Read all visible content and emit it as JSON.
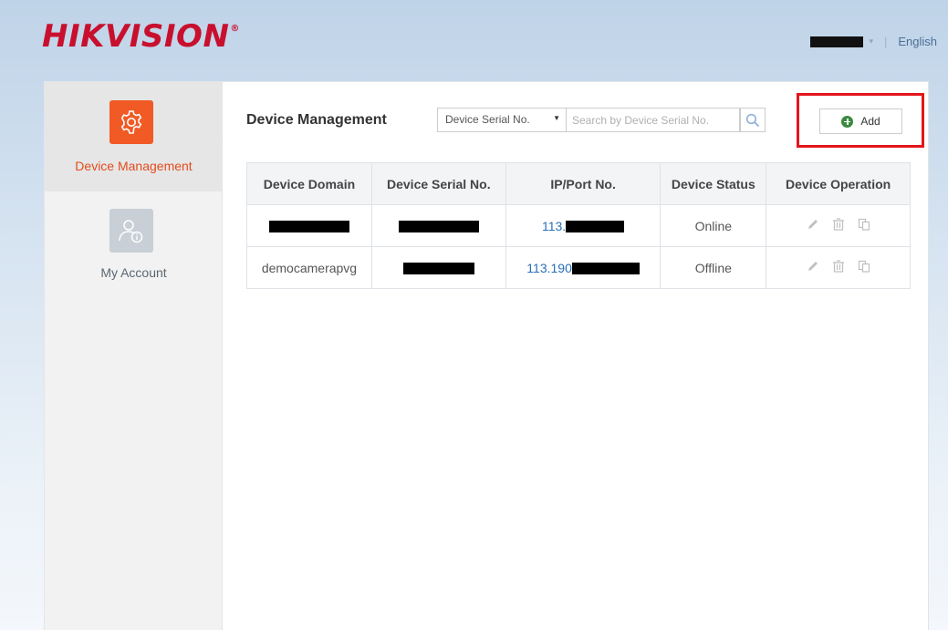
{
  "header": {
    "logo_text": "HIKVISION",
    "logo_mark": "®",
    "user_caret": "▾",
    "language_label": "English"
  },
  "sidebar": {
    "items": [
      {
        "label": "Device Management",
        "icon": "gear-icon",
        "active": true
      },
      {
        "label": "My Account",
        "icon": "account-icon",
        "active": false
      }
    ]
  },
  "main": {
    "title": "Device Management",
    "filter_select_value": "Device Serial No.",
    "filter_arrow": "▼",
    "search_placeholder": "Search by Device Serial No.",
    "add_label": "Add"
  },
  "table": {
    "headers": [
      "Device Domain",
      "Device Serial No.",
      "IP/Port No.",
      "Device Status",
      "Device Operation"
    ],
    "rows": [
      {
        "domain": "",
        "serial": "",
        "ip_prefix": "113.",
        "status": "Online"
      },
      {
        "domain": "democamerapvg",
        "serial": "",
        "ip_prefix": "113.190",
        "status": "Offline"
      }
    ]
  },
  "colors": {
    "brand_red": "#c8102e",
    "accent_orange": "#f15a24",
    "online_green": "#5aa22e",
    "offline_orange": "#e8731c",
    "link_blue": "#2a6fb8",
    "highlight_red": "#e3161b"
  }
}
